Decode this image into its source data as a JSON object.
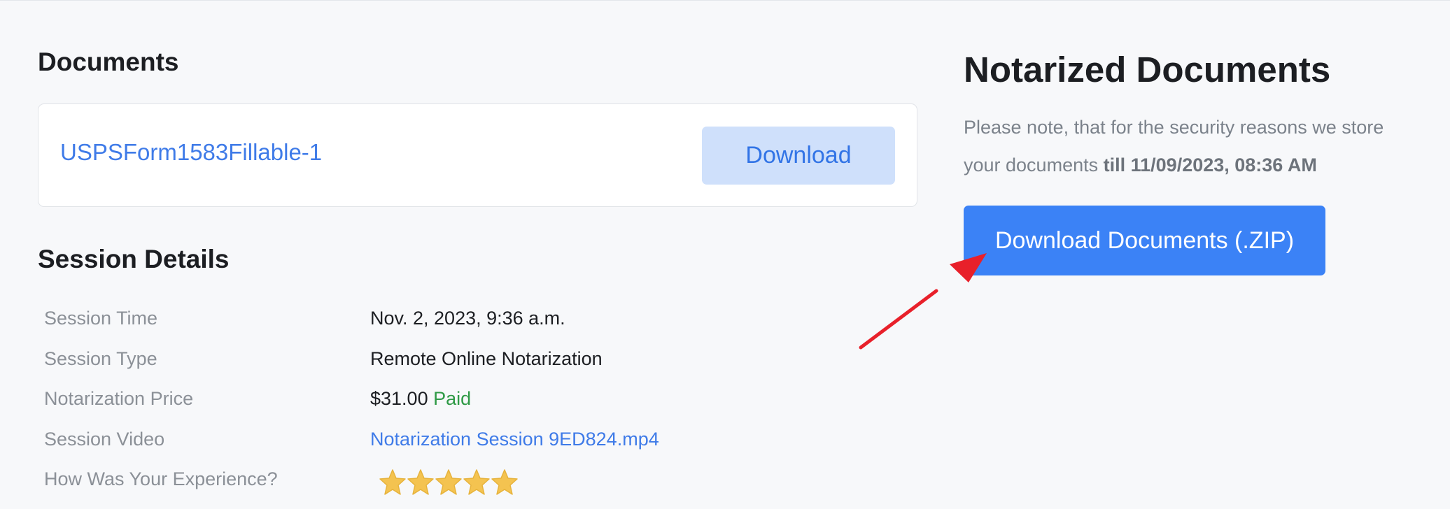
{
  "documents": {
    "heading": "Documents",
    "file_name": "USPSForm1583Fillable-1",
    "download_label": "Download"
  },
  "session": {
    "heading": "Session Details",
    "rows": [
      {
        "label": "Session Time",
        "value": "Nov. 2, 2023, 9:36 a.m."
      },
      {
        "label": "Session Type",
        "value": "Remote Online Notarization"
      },
      {
        "label": "Notarization Price",
        "value": "$31.00",
        "status": "Paid"
      },
      {
        "label": "Session Video",
        "value": "Notarization Session 9ED824.mp4"
      },
      {
        "label": "How Was Your Experience?",
        "rating": 5,
        "rating_max": 5
      }
    ]
  },
  "notarized": {
    "heading": "Notarized Documents",
    "note_prefix": "Please note, that for the security reasons we store your documents",
    "note_emphasis": "till 11/09/2023, 08:36 AM",
    "zip_button_label": "Download Documents (.ZIP)"
  },
  "annotation": {
    "arrow_color": "#e8202a",
    "points_to": "zip-download-button"
  },
  "colors": {
    "link": "#3f7be8",
    "primary_button": "#3b82f6",
    "secondary_button_bg": "#cfe0fb",
    "paid": "#2f9a46",
    "star": "#f4c350"
  }
}
